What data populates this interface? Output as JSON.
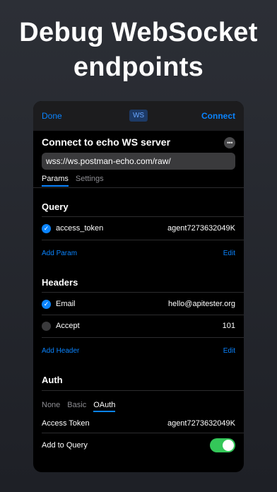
{
  "headline": {
    "line1": "Debug WebSocket",
    "line2": "endpoints"
  },
  "nav": {
    "done": "Done",
    "badge": "WS",
    "connect": "Connect"
  },
  "request": {
    "title": "Connect to echo WS server",
    "more_glyph": "•••",
    "url": "wss://ws.postman-echo.com/raw/"
  },
  "tabs": [
    "Params",
    "Settings"
  ],
  "query": {
    "title": "Query",
    "items": [
      {
        "key": "access_token",
        "value": "agent7273632049K",
        "enabled": true
      }
    ],
    "add_label": "Add Param",
    "edit_label": "Edit"
  },
  "headers": {
    "title": "Headers",
    "items": [
      {
        "key": "Email",
        "value": "hello@apitester.org",
        "enabled": true
      },
      {
        "key": "Accept",
        "value": "101",
        "enabled": false
      }
    ],
    "add_label": "Add Header",
    "edit_label": "Edit"
  },
  "auth": {
    "title": "Auth",
    "tabs": [
      "None",
      "Basic",
      "OAuth"
    ],
    "access_token_label": "Access Token",
    "access_token_value": "agent7273632049K",
    "add_to_query_label": "Add to Query",
    "add_to_query": true
  },
  "colors": {
    "accent": "#0a84ff",
    "toggle_on": "#34c759"
  },
  "icons": {
    "check": "checkmark-icon",
    "more": "ellipsis-icon"
  }
}
